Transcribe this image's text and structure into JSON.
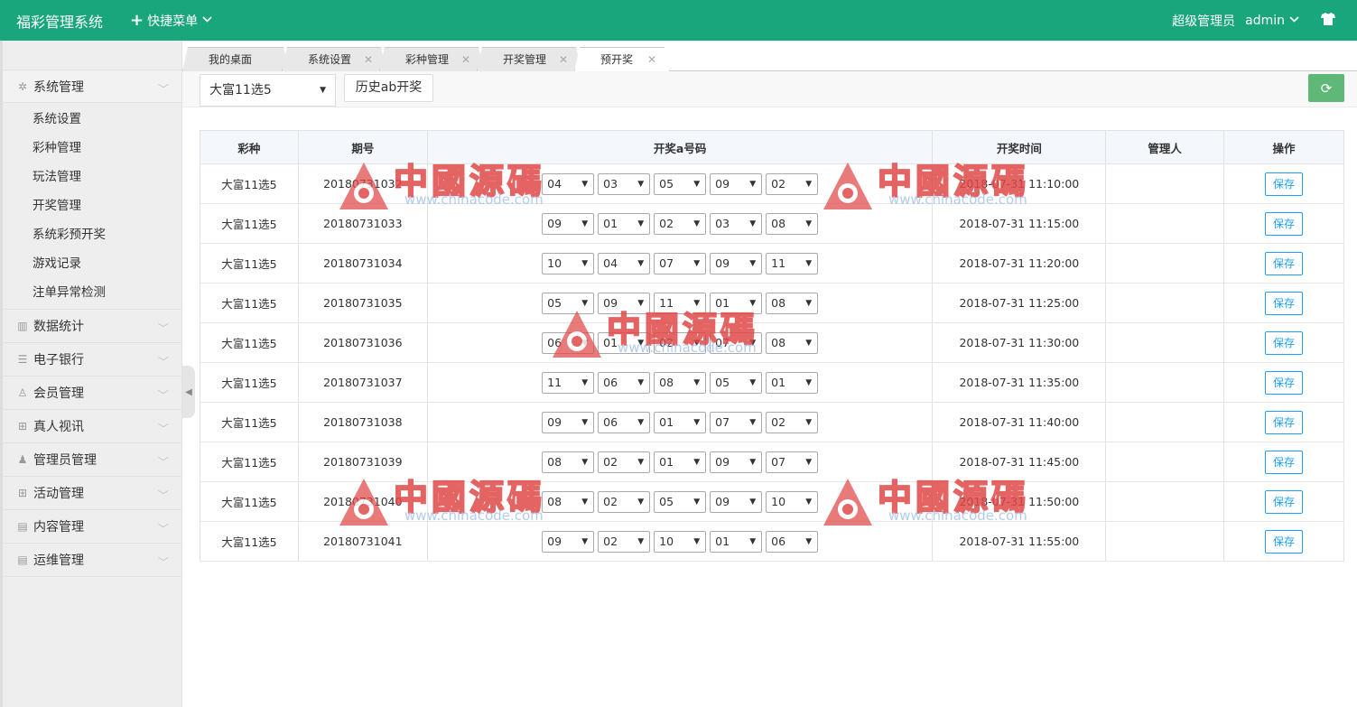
{
  "app": {
    "title": "福彩管理系统",
    "quick_menu": "快捷菜单",
    "role": "超级管理员",
    "user": "admin"
  },
  "sidebar": {
    "groups": [
      {
        "label": "系统管理",
        "icon": "gear-icon"
      },
      {
        "label": "数据统计",
        "icon": "bar-chart-icon"
      },
      {
        "label": "电子银行",
        "icon": "list-icon"
      },
      {
        "label": "会员管理",
        "icon": "user-outline-icon"
      },
      {
        "label": "真人视讯",
        "icon": "gift-icon"
      },
      {
        "label": "管理员管理",
        "icon": "user-icon"
      },
      {
        "label": "活动管理",
        "icon": "gift-icon"
      },
      {
        "label": "内容管理",
        "icon": "document-icon"
      },
      {
        "label": "运维管理",
        "icon": "document-icon"
      }
    ],
    "sub_items": [
      "系统设置",
      "彩种管理",
      "玩法管理",
      "开奖管理",
      "系统彩预开奖",
      "游戏记录",
      "注单异常检测"
    ]
  },
  "tabs": [
    {
      "label": "我的桌面",
      "closable": false
    },
    {
      "label": "系统设置",
      "closable": true
    },
    {
      "label": "彩种管理",
      "closable": true
    },
    {
      "label": "开奖管理",
      "closable": true
    },
    {
      "label": "预开奖",
      "closable": true,
      "active": true
    }
  ],
  "toolbar": {
    "lottery_select": "大富11选5",
    "history_button": "历史ab开奖"
  },
  "table": {
    "headers": [
      "彩种",
      "期号",
      "开奖a号码",
      "开奖时间",
      "管理人",
      "操作"
    ],
    "save_label": "保存",
    "rows": [
      {
        "lottery": "大富11选5",
        "issue": "20180731032",
        "nums": [
          "04",
          "03",
          "05",
          "09",
          "02"
        ],
        "time": "2018-07-31 11:10:00",
        "manager": ""
      },
      {
        "lottery": "大富11选5",
        "issue": "20180731033",
        "nums": [
          "09",
          "01",
          "02",
          "03",
          "08"
        ],
        "time": "2018-07-31 11:15:00",
        "manager": ""
      },
      {
        "lottery": "大富11选5",
        "issue": "20180731034",
        "nums": [
          "10",
          "04",
          "07",
          "09",
          "11"
        ],
        "time": "2018-07-31 11:20:00",
        "manager": ""
      },
      {
        "lottery": "大富11选5",
        "issue": "20180731035",
        "nums": [
          "05",
          "09",
          "11",
          "01",
          "08"
        ],
        "time": "2018-07-31 11:25:00",
        "manager": ""
      },
      {
        "lottery": "大富11选5",
        "issue": "20180731036",
        "nums": [
          "06",
          "01",
          "02",
          "07",
          "08"
        ],
        "time": "2018-07-31 11:30:00",
        "manager": ""
      },
      {
        "lottery": "大富11选5",
        "issue": "20180731037",
        "nums": [
          "11",
          "06",
          "08",
          "05",
          "01"
        ],
        "time": "2018-07-31 11:35:00",
        "manager": ""
      },
      {
        "lottery": "大富11选5",
        "issue": "20180731038",
        "nums": [
          "09",
          "06",
          "01",
          "07",
          "02"
        ],
        "time": "2018-07-31 11:40:00",
        "manager": ""
      },
      {
        "lottery": "大富11选5",
        "issue": "20180731039",
        "nums": [
          "08",
          "02",
          "01",
          "09",
          "07"
        ],
        "time": "2018-07-31 11:45:00",
        "manager": ""
      },
      {
        "lottery": "大富11选5",
        "issue": "20180731040",
        "nums": [
          "08",
          "02",
          "05",
          "09",
          "10"
        ],
        "time": "2018-07-31 11:50:00",
        "manager": ""
      },
      {
        "lottery": "大富11选5",
        "issue": "20180731041",
        "nums": [
          "09",
          "02",
          "10",
          "01",
          "06"
        ],
        "time": "2018-07-31 11:55:00",
        "manager": ""
      }
    ]
  },
  "watermark": {
    "text": "中國源碼",
    "url": "www.chinacode.com"
  },
  "colors": {
    "topbar": "#1aa67c",
    "refresh_button": "#5fb878",
    "save_button": "#1e9fff",
    "watermark": "#e04848"
  }
}
